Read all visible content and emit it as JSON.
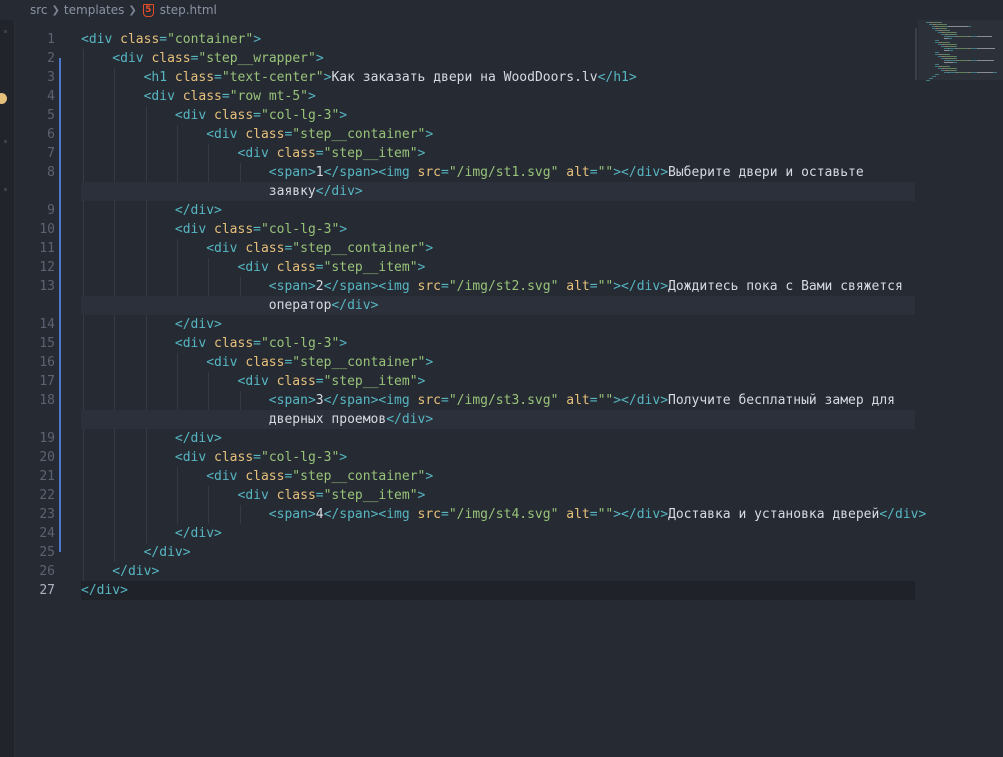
{
  "breadcrumb": {
    "items": [
      "src",
      "templates",
      "step.html"
    ],
    "file_icon": "html5-icon"
  },
  "editor": {
    "active_line": 27,
    "lines": [
      {
        "n": "1",
        "indent": 0,
        "tokens": [
          [
            "p",
            "<"
          ],
          [
            "t",
            "div"
          ],
          [
            "p",
            " "
          ],
          [
            "a",
            "class"
          ],
          [
            "p",
            "="
          ],
          [
            "s",
            "\"container\""
          ],
          [
            "p",
            ">"
          ]
        ]
      },
      {
        "n": "2",
        "indent": 1,
        "tokens": [
          [
            "p",
            "<"
          ],
          [
            "t",
            "div"
          ],
          [
            "p",
            " "
          ],
          [
            "a",
            "class"
          ],
          [
            "p",
            "="
          ],
          [
            "s",
            "\"step__wrapper\""
          ],
          [
            "p",
            ">"
          ]
        ]
      },
      {
        "n": "3",
        "indent": 2,
        "tokens": [
          [
            "p",
            "<"
          ],
          [
            "t",
            "h1"
          ],
          [
            "p",
            " "
          ],
          [
            "a",
            "class"
          ],
          [
            "p",
            "="
          ],
          [
            "s",
            "\"text-center\""
          ],
          [
            "p",
            ">"
          ],
          [
            "x",
            "Как заказать двери на WoodDoors.lv"
          ],
          [
            "p",
            "</"
          ],
          [
            "t",
            "h1"
          ],
          [
            "p",
            ">"
          ]
        ]
      },
      {
        "n": "4",
        "indent": 2,
        "tokens": [
          [
            "p",
            "<"
          ],
          [
            "t",
            "div"
          ],
          [
            "p",
            " "
          ],
          [
            "a",
            "class"
          ],
          [
            "p",
            "="
          ],
          [
            "s",
            "\"row mt-5\""
          ],
          [
            "p",
            ">"
          ]
        ]
      },
      {
        "n": "5",
        "indent": 3,
        "tokens": [
          [
            "p",
            "<"
          ],
          [
            "t",
            "div"
          ],
          [
            "p",
            " "
          ],
          [
            "a",
            "class"
          ],
          [
            "p",
            "="
          ],
          [
            "s",
            "\"col-lg-3\""
          ],
          [
            "p",
            ">"
          ]
        ]
      },
      {
        "n": "6",
        "indent": 4,
        "tokens": [
          [
            "p",
            "<"
          ],
          [
            "t",
            "div"
          ],
          [
            "p",
            " "
          ],
          [
            "a",
            "class"
          ],
          [
            "p",
            "="
          ],
          [
            "s",
            "\"step__container\""
          ],
          [
            "p",
            ">"
          ]
        ]
      },
      {
        "n": "7",
        "indent": 5,
        "tokens": [
          [
            "p",
            "<"
          ],
          [
            "t",
            "div"
          ],
          [
            "p",
            " "
          ],
          [
            "a",
            "class"
          ],
          [
            "p",
            "="
          ],
          [
            "s",
            "\"step__item\""
          ],
          [
            "p",
            ">"
          ]
        ]
      },
      {
        "n": "8",
        "indent": 6,
        "tokens": [
          [
            "p",
            "<"
          ],
          [
            "t",
            "span"
          ],
          [
            "p",
            ">"
          ],
          [
            "x",
            "1"
          ],
          [
            "p",
            "</"
          ],
          [
            "t",
            "span"
          ],
          [
            "p",
            "><"
          ],
          [
            "t",
            "img"
          ],
          [
            "p",
            " "
          ],
          [
            "a",
            "src"
          ],
          [
            "p",
            "="
          ],
          [
            "s",
            "\"/img/st1.svg\""
          ],
          [
            "p",
            " "
          ],
          [
            "a",
            "alt"
          ],
          [
            "p",
            "="
          ],
          [
            "s",
            "\"\""
          ],
          [
            "p",
            "></"
          ],
          [
            "t",
            "div"
          ],
          [
            "p",
            ">"
          ],
          [
            "x",
            "Выберите двери и оставьте"
          ]
        ]
      },
      {
        "n": "",
        "indent": 6,
        "wrap": true,
        "tokens": [
          [
            "x",
            "заявку"
          ],
          [
            "p",
            "</"
          ],
          [
            "t",
            "div"
          ],
          [
            "p",
            ">"
          ]
        ]
      },
      {
        "n": "9",
        "indent": 3,
        "tokens": [
          [
            "p",
            "</"
          ],
          [
            "t",
            "div"
          ],
          [
            "p",
            ">"
          ]
        ]
      },
      {
        "n": "10",
        "indent": 3,
        "tokens": [
          [
            "p",
            "<"
          ],
          [
            "t",
            "div"
          ],
          [
            "p",
            " "
          ],
          [
            "a",
            "class"
          ],
          [
            "p",
            "="
          ],
          [
            "s",
            "\"col-lg-3\""
          ],
          [
            "p",
            ">"
          ]
        ]
      },
      {
        "n": "11",
        "indent": 4,
        "tokens": [
          [
            "p",
            "<"
          ],
          [
            "t",
            "div"
          ],
          [
            "p",
            " "
          ],
          [
            "a",
            "class"
          ],
          [
            "p",
            "="
          ],
          [
            "s",
            "\"step__container\""
          ],
          [
            "p",
            ">"
          ]
        ]
      },
      {
        "n": "12",
        "indent": 5,
        "tokens": [
          [
            "p",
            "<"
          ],
          [
            "t",
            "div"
          ],
          [
            "p",
            " "
          ],
          [
            "a",
            "class"
          ],
          [
            "p",
            "="
          ],
          [
            "s",
            "\"step__item\""
          ],
          [
            "p",
            ">"
          ]
        ]
      },
      {
        "n": "13",
        "indent": 6,
        "tokens": [
          [
            "p",
            "<"
          ],
          [
            "t",
            "span"
          ],
          [
            "p",
            ">"
          ],
          [
            "x",
            "2"
          ],
          [
            "p",
            "</"
          ],
          [
            "t",
            "span"
          ],
          [
            "p",
            "><"
          ],
          [
            "t",
            "img"
          ],
          [
            "p",
            " "
          ],
          [
            "a",
            "src"
          ],
          [
            "p",
            "="
          ],
          [
            "s",
            "\"/img/st2.svg\""
          ],
          [
            "p",
            " "
          ],
          [
            "a",
            "alt"
          ],
          [
            "p",
            "="
          ],
          [
            "s",
            "\"\""
          ],
          [
            "p",
            "></"
          ],
          [
            "t",
            "div"
          ],
          [
            "p",
            ">"
          ],
          [
            "x",
            "Дождитесь пока с Вами свяжется"
          ]
        ]
      },
      {
        "n": "",
        "indent": 6,
        "wrap": true,
        "tokens": [
          [
            "x",
            "оператор"
          ],
          [
            "p",
            "</"
          ],
          [
            "t",
            "div"
          ],
          [
            "p",
            ">"
          ]
        ]
      },
      {
        "n": "14",
        "indent": 3,
        "tokens": [
          [
            "p",
            "</"
          ],
          [
            "t",
            "div"
          ],
          [
            "p",
            ">"
          ]
        ]
      },
      {
        "n": "15",
        "indent": 3,
        "tokens": [
          [
            "p",
            "<"
          ],
          [
            "t",
            "div"
          ],
          [
            "p",
            " "
          ],
          [
            "a",
            "class"
          ],
          [
            "p",
            "="
          ],
          [
            "s",
            "\"col-lg-3\""
          ],
          [
            "p",
            ">"
          ]
        ]
      },
      {
        "n": "16",
        "indent": 4,
        "tokens": [
          [
            "p",
            "<"
          ],
          [
            "t",
            "div"
          ],
          [
            "p",
            " "
          ],
          [
            "a",
            "class"
          ],
          [
            "p",
            "="
          ],
          [
            "s",
            "\"step__container\""
          ],
          [
            "p",
            ">"
          ]
        ]
      },
      {
        "n": "17",
        "indent": 5,
        "tokens": [
          [
            "p",
            "<"
          ],
          [
            "t",
            "div"
          ],
          [
            "p",
            " "
          ],
          [
            "a",
            "class"
          ],
          [
            "p",
            "="
          ],
          [
            "s",
            "\"step__item\""
          ],
          [
            "p",
            ">"
          ]
        ]
      },
      {
        "n": "18",
        "indent": 6,
        "tokens": [
          [
            "p",
            "<"
          ],
          [
            "t",
            "span"
          ],
          [
            "p",
            ">"
          ],
          [
            "x",
            "3"
          ],
          [
            "p",
            "</"
          ],
          [
            "t",
            "span"
          ],
          [
            "p",
            "><"
          ],
          [
            "t",
            "img"
          ],
          [
            "p",
            " "
          ],
          [
            "a",
            "src"
          ],
          [
            "p",
            "="
          ],
          [
            "s",
            "\"/img/st3.svg\""
          ],
          [
            "p",
            " "
          ],
          [
            "a",
            "alt"
          ],
          [
            "p",
            "="
          ],
          [
            "s",
            "\"\""
          ],
          [
            "p",
            "></"
          ],
          [
            "t",
            "div"
          ],
          [
            "p",
            ">"
          ],
          [
            "x",
            "Получите бесплатный замер для"
          ]
        ]
      },
      {
        "n": "",
        "indent": 6,
        "wrap": true,
        "tokens": [
          [
            "x",
            "дверных проемов"
          ],
          [
            "p",
            "</"
          ],
          [
            "t",
            "div"
          ],
          [
            "p",
            ">"
          ]
        ]
      },
      {
        "n": "19",
        "indent": 3,
        "tokens": [
          [
            "p",
            "</"
          ],
          [
            "t",
            "div"
          ],
          [
            "p",
            ">"
          ]
        ]
      },
      {
        "n": "20",
        "indent": 3,
        "tokens": [
          [
            "p",
            "<"
          ],
          [
            "t",
            "div"
          ],
          [
            "p",
            " "
          ],
          [
            "a",
            "class"
          ],
          [
            "p",
            "="
          ],
          [
            "s",
            "\"col-lg-3\""
          ],
          [
            "p",
            ">"
          ]
        ]
      },
      {
        "n": "21",
        "indent": 4,
        "tokens": [
          [
            "p",
            "<"
          ],
          [
            "t",
            "div"
          ],
          [
            "p",
            " "
          ],
          [
            "a",
            "class"
          ],
          [
            "p",
            "="
          ],
          [
            "s",
            "\"step__container\""
          ],
          [
            "p",
            ">"
          ]
        ]
      },
      {
        "n": "22",
        "indent": 5,
        "tokens": [
          [
            "p",
            "<"
          ],
          [
            "t",
            "div"
          ],
          [
            "p",
            " "
          ],
          [
            "a",
            "class"
          ],
          [
            "p",
            "="
          ],
          [
            "s",
            "\"step__item\""
          ],
          [
            "p",
            ">"
          ]
        ]
      },
      {
        "n": "23",
        "indent": 6,
        "tokens": [
          [
            "p",
            "<"
          ],
          [
            "t",
            "span"
          ],
          [
            "p",
            ">"
          ],
          [
            "x",
            "4"
          ],
          [
            "p",
            "</"
          ],
          [
            "t",
            "span"
          ],
          [
            "p",
            "><"
          ],
          [
            "t",
            "img"
          ],
          [
            "p",
            " "
          ],
          [
            "a",
            "src"
          ],
          [
            "p",
            "="
          ],
          [
            "s",
            "\"/img/st4.svg\""
          ],
          [
            "p",
            " "
          ],
          [
            "a",
            "alt"
          ],
          [
            "p",
            "="
          ],
          [
            "s",
            "\"\""
          ],
          [
            "p",
            "></"
          ],
          [
            "t",
            "div"
          ],
          [
            "p",
            ">"
          ],
          [
            "x",
            "Доставка и установка дверей"
          ],
          [
            "p",
            "</"
          ],
          [
            "t",
            "div"
          ],
          [
            "p",
            ">"
          ]
        ]
      },
      {
        "n": "24",
        "indent": 3,
        "tokens": [
          [
            "p",
            "</"
          ],
          [
            "t",
            "div"
          ],
          [
            "p",
            ">"
          ]
        ]
      },
      {
        "n": "25",
        "indent": 2,
        "tokens": [
          [
            "p",
            "</"
          ],
          [
            "t",
            "div"
          ],
          [
            "p",
            ">"
          ]
        ]
      },
      {
        "n": "26",
        "indent": 1,
        "tokens": [
          [
            "p",
            "</"
          ],
          [
            "t",
            "div"
          ],
          [
            "p",
            ">"
          ]
        ]
      },
      {
        "n": "27",
        "indent": 0,
        "tokens": [
          [
            "p",
            "</"
          ],
          [
            "t",
            "div"
          ],
          [
            "p",
            ">"
          ]
        ]
      }
    ]
  },
  "colors": {
    "background": "#262a33",
    "tag": "#56b6c2",
    "attribute": "#e6c07b",
    "string": "#98c379",
    "text": "#d7dae0",
    "warning": "#e5c07b",
    "html5": "#e44d26"
  }
}
